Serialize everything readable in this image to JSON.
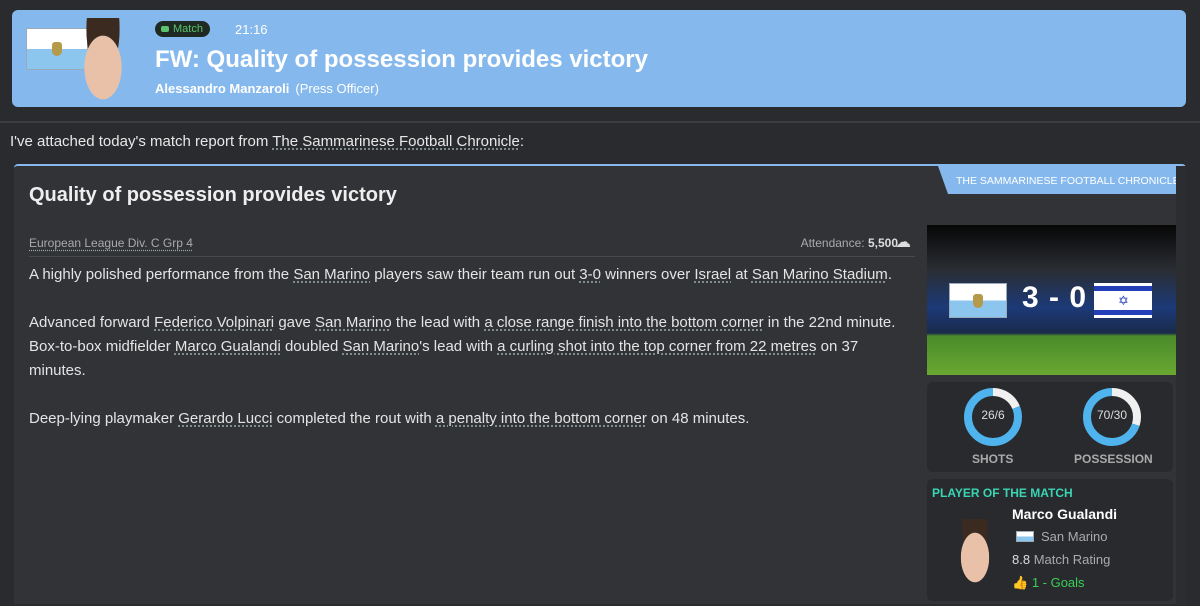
{
  "header": {
    "badge": "Match",
    "time": "21:16",
    "title": "FW: Quality of possession provides victory",
    "sender": "Alessandro Manzaroli",
    "role": "(Press Officer)"
  },
  "intro": {
    "text": "I've attached today's match report from ",
    "link": "The Sammarinese Football Chronicle",
    "end": ":"
  },
  "report": {
    "source_tab": "THE SAMMARINESE FOOTBALL CHRONICLE",
    "title": "Quality of possession provides victory",
    "competition": "European League Div. C Grp 4",
    "attendance_label": "Attendance:",
    "attendance": "5,500",
    "weather_icon": "cloud-rain-icon",
    "paragraphs": [
      [
        {
          "t": "A highly polished performance from the "
        },
        {
          "t": "San Marino",
          "l": true
        },
        {
          "t": " players saw their team run out "
        },
        {
          "t": "3-0",
          "l": true
        },
        {
          "t": " winners over "
        },
        {
          "t": "Israel",
          "l": true
        },
        {
          "t": " at "
        },
        {
          "t": "San Marino Stadium",
          "l": true
        },
        {
          "t": "."
        }
      ],
      [
        {
          "t": "Advanced forward "
        },
        {
          "t": "Federico Volpinari",
          "l": true
        },
        {
          "t": " gave "
        },
        {
          "t": "San Marino",
          "l": true
        },
        {
          "t": " the lead with "
        },
        {
          "t": "a close range finish into the bottom corner",
          "l": true
        },
        {
          "t": " in the 22nd minute. Box-to-box midfielder "
        },
        {
          "t": "Marco Gualandi",
          "l": true
        },
        {
          "t": " doubled "
        },
        {
          "t": "San Marino",
          "l": true
        },
        {
          "t": "'s lead with "
        },
        {
          "t": "a curling shot into the top corner from 22 metres",
          "l": true
        },
        {
          "t": " on 37 minutes."
        }
      ],
      [
        {
          "t": "Deep-lying playmaker "
        },
        {
          "t": "Gerardo Lucci",
          "l": true
        },
        {
          "t": " completed the rout with "
        },
        {
          "t": "a penalty into the bottom corner",
          "l": true
        },
        {
          "t": " on 48 minutes."
        }
      ]
    ]
  },
  "match": {
    "score": "3 - 0",
    "home": "San Marino",
    "away": "Israel"
  },
  "stats": {
    "shots": {
      "label": "SHOTS",
      "value": "26/6",
      "home": 26,
      "away": 6
    },
    "possession": {
      "label": "POSSESSION",
      "value": "70/30",
      "home": 70,
      "away": 30
    },
    "colors": {
      "home": "#4fb3ee",
      "away": "#f0f0f0"
    }
  },
  "potm": {
    "heading": "PLAYER OF THE MATCH",
    "name": "Marco Gualandi",
    "club": "San Marino",
    "rating": "8.8",
    "rating_label": "Match Rating",
    "goals": "1 - Goals"
  }
}
